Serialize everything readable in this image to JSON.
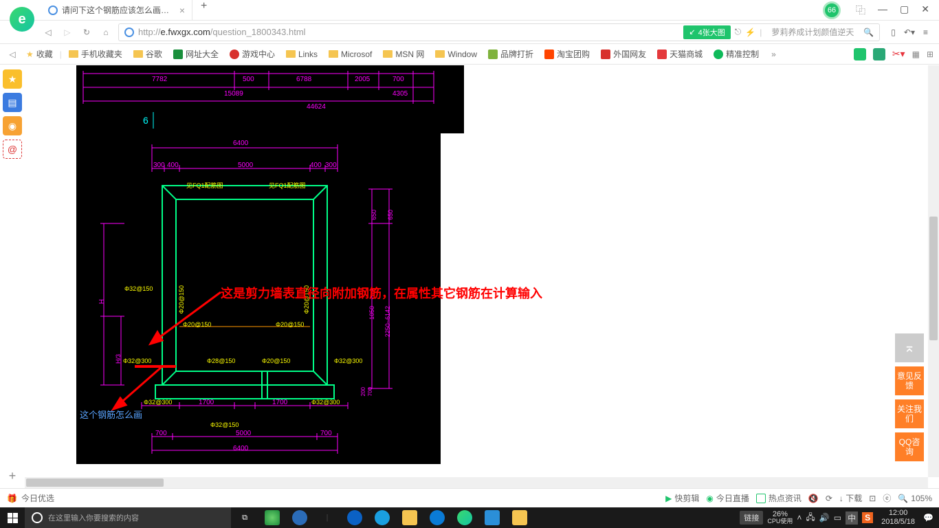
{
  "titlebar": {
    "tab_title": "请问下这个钢筋应该怎么画？_广",
    "badge": "66"
  },
  "address": {
    "url_prefix": "http://",
    "url_domain": "e.fwxgx.com",
    "url_path": "/question_1800343.html",
    "img_badge": "4张大图",
    "search_hint": "萝莉养成计划颜值逆天"
  },
  "bookmarks": {
    "fav": "收藏",
    "items": [
      {
        "label": "手机收藏夹"
      },
      {
        "label": "谷歌"
      },
      {
        "label": "网址大全"
      },
      {
        "label": "游戏中心"
      },
      {
        "label": "Links"
      },
      {
        "label": "Microsof"
      },
      {
        "label": "MSN 网"
      },
      {
        "label": "Window"
      },
      {
        "label": "品牌打折"
      },
      {
        "label": "淘宝团购"
      },
      {
        "label": "外国网友"
      },
      {
        "label": "天猫商城"
      },
      {
        "label": "精准控制"
      }
    ]
  },
  "cad": {
    "dims": {
      "d7782": "7782",
      "d500": "500",
      "d6788": "6788",
      "d2005": "2005",
      "d700a": "700",
      "d15089": "15089",
      "d4305": "4305",
      "d44624": "44624",
      "d6": "6",
      "d6400": "6400",
      "d300a": "300",
      "d400a": "400",
      "d5000": "5000",
      "d400b": "400",
      "d300b": "300",
      "fq1a": "见FQ1配筋图",
      "fq1b": "见FQ1配筋图",
      "d650a": "650",
      "d650b": "650",
      "d2250": "2250~6142",
      "d1050": "1050",
      "r32_150a": "Φ32@150",
      "r20_150a": "Φ20@150",
      "r20_150b": "Φ20@150",
      "r20_150c": "Φ20@150",
      "r32_300a": "Φ32@300",
      "r28_150": "Φ28@150",
      "r20_150d": "Φ20@150",
      "r32_300b": "Φ32@300",
      "r32_300c": "Φ32@300",
      "r32_300d": "Φ32@300",
      "r32_150b": "Φ32@150",
      "d1700a": "1700",
      "d1700b": "1700",
      "d700b": "700",
      "d700c": "700",
      "d5000b": "5000",
      "d6400b": "6400",
      "d200": "200",
      "d700d": "700",
      "H": "H",
      "H3": "H/3"
    },
    "ann_red": "这是剪力墙表直径向附加钢筋，在属性其它钢筋在计算输入",
    "ann_blue": "这个钢筋怎么画"
  },
  "float": {
    "b1": "意见反馈",
    "b2": "关注我们",
    "b3": "QQ咨询"
  },
  "status": {
    "left": "今日优选",
    "items": [
      "快剪辑",
      "今日直播",
      "热点资讯",
      "↓ 下载"
    ],
    "zoom": "105%"
  },
  "taskbar": {
    "search": "在这里输入你要搜索的内容",
    "link": "链接",
    "cpu_pct": "26%",
    "cpu_lbl": "CPU使用",
    "ime": "中",
    "sogou": "S",
    "time": "12:00",
    "date": "2018/5/18"
  }
}
